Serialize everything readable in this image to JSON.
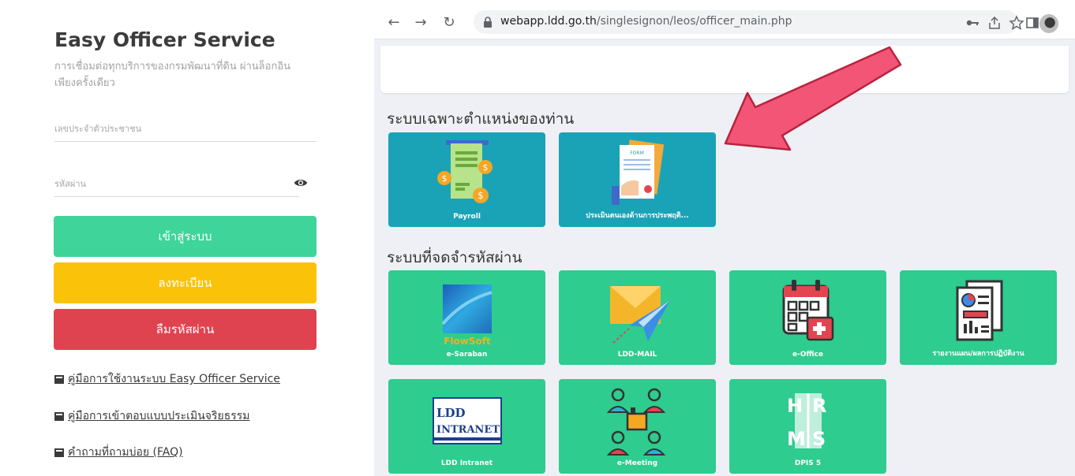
{
  "login": {
    "title": "Easy Officer Service",
    "description": "การเชื่อมต่อทุกบริการของกรมพัฒนาที่ดิน ผ่านล็อกอินเพียงครั้งเดียว",
    "id_placeholder": "เลขประจำตัวประชาชน",
    "password_placeholder": "รหัสผ่าน",
    "login_label": "เข้าสู่ระบบ",
    "register_label": "ลงทะเบียน",
    "forgot_label": "ลืมรหัสผ่าน",
    "links": [
      "คู่มือการใช้งานระบบ Easy Officer Service",
      "คู่มือการเข้าตอบแบบประเมินจริยธรรม",
      "คำถามที่ถามบ่อย (FAQ)"
    ],
    "colors": {
      "login": "#3ed49a",
      "register": "#fbc20a",
      "forgot": "#e04350"
    }
  },
  "browser": {
    "url_host": "webapp.ldd.go.th",
    "url_path": "/singlesignon/leos/officer_main.php",
    "icons": [
      "back-icon",
      "forward-icon",
      "reload-icon",
      "lock-icon",
      "key-icon",
      "share-icon",
      "star-icon",
      "sidepanel-icon",
      "avatar"
    ]
  },
  "sections": [
    {
      "title": "ระบบเฉพาะตำแหน่งของท่าน",
      "tiles": [
        {
          "label": "Payroll",
          "icon": "payroll-icon"
        },
        {
          "label": "ประเมินตนเองด้านการประพฤติ...",
          "icon": "form-icon"
        }
      ]
    },
    {
      "title": "ระบบที่จดจำรหัสผ่าน",
      "tiles": [
        {
          "label": "e-Saraban",
          "icon": "flowsoft-icon",
          "logo_text": "FlowSoft"
        },
        {
          "label": "LDD-MAIL",
          "icon": "mail-icon"
        },
        {
          "label": "e-Office",
          "icon": "calendar-icon"
        },
        {
          "label": "รายงานแผน/ผลการปฏิบัติงาน",
          "icon": "report-icon"
        },
        {
          "label": "LDD Intranet",
          "icon": "intranet-icon",
          "logo_text": [
            "LDD",
            "INTRANET"
          ]
        },
        {
          "label": "e-Meeting",
          "icon": "meeting-icon"
        },
        {
          "label": "DPIS 5",
          "icon": "hrms-icon",
          "logo_text": "HRMS"
        }
      ]
    }
  ],
  "colors": {
    "tile_blue": "#1aa3b7",
    "tile_green": "#2ecc8f",
    "arrow": "#f25576"
  }
}
